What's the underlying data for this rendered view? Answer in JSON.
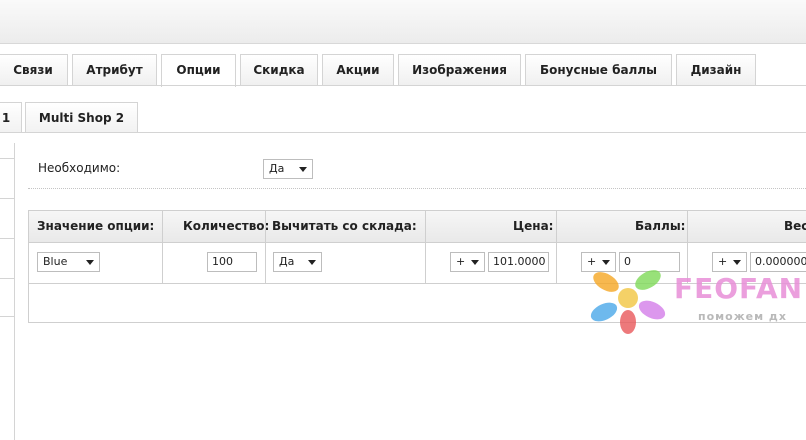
{
  "main_tabs": [
    "Связи",
    "Атрибут",
    "Опции",
    "Скидка",
    "Акции",
    "Изображения",
    "Бонусные баллы",
    "Дизайн"
  ],
  "active_main_tab": "Опции",
  "sub_tabs": [
    "1",
    "Multi Shop 2"
  ],
  "required": {
    "label": "Необходимо:",
    "value": "Да"
  },
  "table": {
    "headers": {
      "option_value": "Значение опции:",
      "quantity": "Количество:",
      "subtract": "Вычитать со склада:",
      "price": "Цена:",
      "points": "Баллы:",
      "weight": "Вес"
    },
    "row": {
      "option_value": "Blue",
      "quantity": "100",
      "subtract": "Да",
      "price_prefix": "+",
      "price": "101.0000",
      "points_prefix": "+",
      "points": "0",
      "weight_prefix": "+",
      "weight": "0.000000"
    }
  },
  "watermark": {
    "title": "FEOFAN",
    "subtitle": "поможем дх"
  }
}
